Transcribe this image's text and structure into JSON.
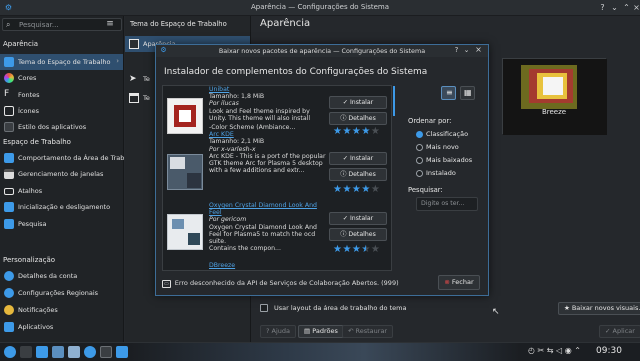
{
  "window": {
    "title": "Aparência — Configurações do Sistema"
  },
  "sidebar": {
    "search_placeholder": "Pesquisar...",
    "sections": [
      "Aparência",
      "Espaço de Trabalho",
      "Personalização"
    ],
    "items": [
      {
        "label": "Tema do Espaço de Trabalho",
        "color": "#3d9ae8"
      },
      {
        "label": "Cores",
        "color": "#e85e3d"
      },
      {
        "label": "Fontes",
        "color": "#e6e6e6"
      },
      {
        "label": "Ícones",
        "color": "#e6e6e6"
      },
      {
        "label": "Estilo dos aplicativos",
        "color": "#3a3e42"
      },
      {
        "label": "Comportamento da Área de Trab...",
        "color": "#3d9ae8"
      },
      {
        "label": "Gerenciamento de janelas",
        "color": "#dcdcdc"
      },
      {
        "label": "Atalhos",
        "color": "#e6e6e6"
      },
      {
        "label": "Inicialização e desligamento",
        "color": "#3d9ae8"
      },
      {
        "label": "Pesquisa",
        "color": "#3d9ae8"
      },
      {
        "label": "Detalhes da conta",
        "color": "#3d9ae8"
      },
      {
        "label": "Configurações Regionais",
        "color": "#3d9ae8"
      },
      {
        "label": "Notificações",
        "color": "#e6b83d"
      },
      {
        "label": "Aplicativos",
        "color": "#3d9ae8"
      }
    ]
  },
  "subpanel": {
    "header": "Tema do Espaço de Trabalho",
    "items": [
      {
        "label": "Aparência"
      },
      {
        "label": "Te"
      },
      {
        "label": "Te"
      }
    ]
  },
  "main": {
    "title": "Aparência",
    "preview_label": "Breeze",
    "checkbox_label": "Usar layout da área de trabalho do tema",
    "get_new_label": "Baixar novos visuais...",
    "help_label": "Ajuda",
    "defaults_label": "Padrões",
    "reset_label": "Restaurar",
    "apply_label": "Aplicar"
  },
  "dialog": {
    "title": "Baixar novos pacotes de aparência — Configurações do Sistema",
    "heading": "Instalador de complementos do Configurações do Sistema",
    "install_label": "Instalar",
    "details_label": "Detalhes",
    "entries": [
      {
        "name": "Unibat",
        "size": "Tamanho: 1,8 MiB",
        "author": "Por ilucas",
        "desc": "Look and Feel theme inspired by Unity. This theme will also install",
        "rating": 4
      },
      {
        "name": "Arc KDE",
        "pre": "-Color Scheme (Ambiance...",
        "size": "Tamanho: 2,1 MiB",
        "author": "Por x-varlesh-x",
        "desc": "Arc KDE - This is a port of the popular GTK theme Arc for Plasma 5 desktop with a few additions and extr...",
        "rating": 4
      },
      {
        "name": "Oxygen Crystal Diamond Look And Feel",
        "size": "",
        "author": "Por gericom",
        "desc": "Oxygen Crystal Diamond Look And Feel for Plasma5 to match the ocd suite.",
        "extra": "Contains the compon...",
        "rating": 3.5
      },
      {
        "name": "DBreeze"
      }
    ],
    "order_label": "Ordenar por:",
    "order_options": [
      "Classificação",
      "Mais novo",
      "Mais baixados",
      "Instalado"
    ],
    "order_selected": 0,
    "search_label": "Pesquisar:",
    "search_placeholder": "Digite os ter...",
    "error": "Erro desconhecido da API de Serviços de Colaboração Abertos. (999)",
    "close_label": "Fechar"
  },
  "taskbar": {
    "clock": "09:30"
  }
}
